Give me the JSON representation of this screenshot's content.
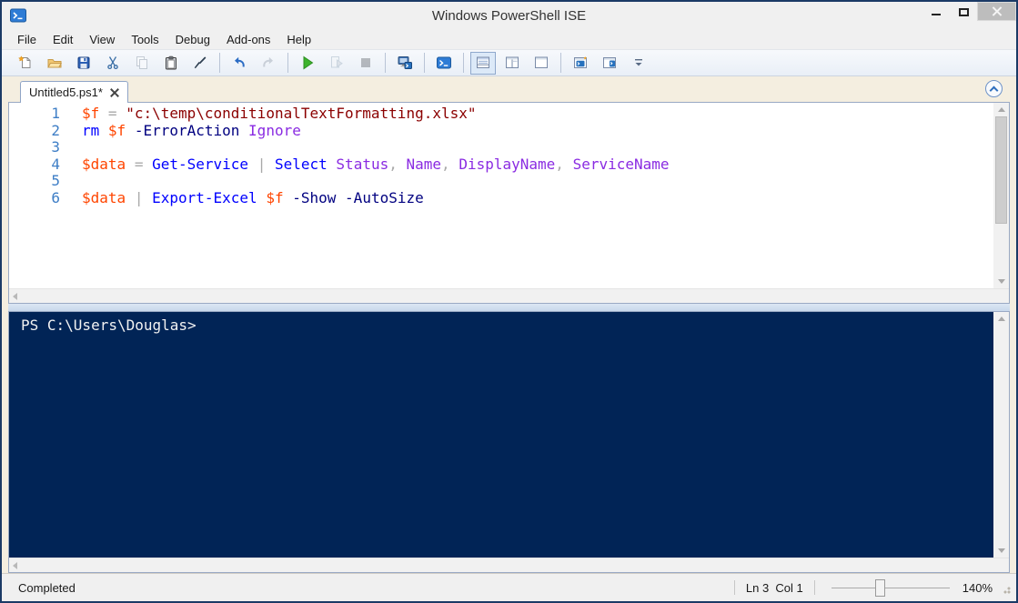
{
  "window": {
    "title": "Windows PowerShell ISE",
    "app_icon": "powershell-icon",
    "controls": {
      "minimize": "minimize",
      "maximize": "maximize",
      "close": "close"
    },
    "border_color": "#1b3a66"
  },
  "menu": {
    "items": [
      "File",
      "Edit",
      "View",
      "Tools",
      "Debug",
      "Add-ons",
      "Help"
    ]
  },
  "toolbar": {
    "buttons": [
      {
        "icon": "new-script-icon"
      },
      {
        "icon": "open-script-icon"
      },
      {
        "icon": "save-icon"
      },
      {
        "icon": "cut-icon"
      },
      {
        "icon": "copy-icon",
        "disabled": true
      },
      {
        "icon": "paste-icon"
      },
      {
        "icon": "clear-console-icon"
      },
      {
        "sep": true
      },
      {
        "icon": "undo-icon"
      },
      {
        "icon": "redo-icon",
        "disabled": true
      },
      {
        "sep": true
      },
      {
        "icon": "run-script-icon"
      },
      {
        "icon": "run-selection-icon",
        "disabled": true
      },
      {
        "icon": "stop-operation-icon",
        "disabled": true
      },
      {
        "sep": true
      },
      {
        "icon": "new-remote-powershell-tab-icon"
      },
      {
        "sep": true
      },
      {
        "icon": "start-powershell-icon"
      },
      {
        "sep": true
      },
      {
        "icon": "script-pane-top-icon",
        "selected": true
      },
      {
        "icon": "script-pane-right-icon"
      },
      {
        "icon": "script-pane-maximized-icon"
      },
      {
        "sep": true
      },
      {
        "icon": "show-command-window-icon"
      },
      {
        "icon": "show-command-addon-icon"
      },
      {
        "icon": "toolbar-overflow-icon"
      }
    ]
  },
  "tabs": {
    "active_label": "Untitled5.ps1*"
  },
  "editor": {
    "lines": [
      {
        "num": "1",
        "tokens": [
          [
            "variable",
            "$f"
          ],
          [
            "plain",
            " "
          ],
          [
            "operator",
            "="
          ],
          [
            "plain",
            " "
          ],
          [
            "string",
            "\"c:\\temp\\conditionalTextFormatting.xlsx\""
          ]
        ]
      },
      {
        "num": "2",
        "tokens": [
          [
            "command",
            "rm"
          ],
          [
            "plain",
            " "
          ],
          [
            "variable",
            "$f"
          ],
          [
            "plain",
            " "
          ],
          [
            "parameter",
            "-ErrorAction"
          ],
          [
            "plain",
            " "
          ],
          [
            "argument",
            "Ignore"
          ]
        ]
      },
      {
        "num": "3",
        "tokens": []
      },
      {
        "num": "4",
        "tokens": [
          [
            "variable",
            "$data"
          ],
          [
            "plain",
            " "
          ],
          [
            "operator",
            "="
          ],
          [
            "plain",
            " "
          ],
          [
            "command",
            "Get-Service"
          ],
          [
            "plain",
            " "
          ],
          [
            "operator",
            "|"
          ],
          [
            "plain",
            " "
          ],
          [
            "command",
            "Select"
          ],
          [
            "plain",
            " "
          ],
          [
            "argument",
            "Status"
          ],
          [
            "operator",
            ","
          ],
          [
            "plain",
            " "
          ],
          [
            "argument",
            "Name"
          ],
          [
            "operator",
            ","
          ],
          [
            "plain",
            " "
          ],
          [
            "argument",
            "DisplayName"
          ],
          [
            "operator",
            ","
          ],
          [
            "plain",
            " "
          ],
          [
            "argument",
            "ServiceName"
          ]
        ]
      },
      {
        "num": "5",
        "tokens": []
      },
      {
        "num": "6",
        "tokens": [
          [
            "variable",
            "$data"
          ],
          [
            "plain",
            " "
          ],
          [
            "operator",
            "|"
          ],
          [
            "plain",
            " "
          ],
          [
            "command",
            "Export-Excel"
          ],
          [
            "plain",
            " "
          ],
          [
            "variable",
            "$f"
          ],
          [
            "plain",
            " "
          ],
          [
            "parameter",
            "-Show"
          ],
          [
            "plain",
            " "
          ],
          [
            "parameter",
            "-AutoSize"
          ]
        ]
      }
    ],
    "syntax_colors": {
      "variable": "#ff4500",
      "operator": "#a9a9a9",
      "string": "#8b0000",
      "command": "#0000ff",
      "parameter": "#000080",
      "argument": "#8a2be2",
      "line_number": "#3e7ec6"
    }
  },
  "console": {
    "prompt": "PS C:\\Users\\Douglas>",
    "background": "#012456",
    "text_color": "#f2f2f2"
  },
  "statusbar": {
    "status": "Completed",
    "line_col": "Ln 3  Col 1",
    "zoom_value": "140%"
  }
}
